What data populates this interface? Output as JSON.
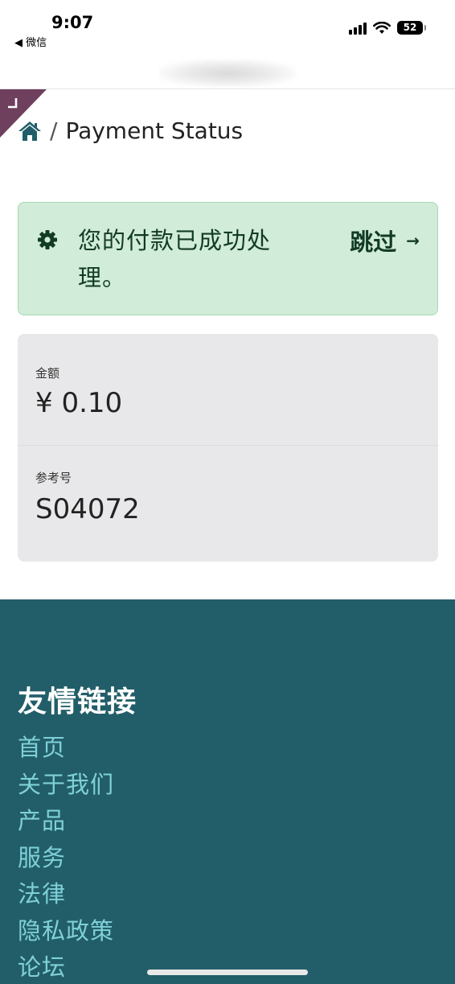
{
  "status_bar": {
    "time": "9:07",
    "back_app": "◀ 微信",
    "battery": "52"
  },
  "breadcrumb": {
    "separator": "/",
    "current": "Payment Status"
  },
  "alert": {
    "message": "您的付款已成功处理。",
    "skip_label": "跳过",
    "skip_arrow": "→",
    "colors": {
      "background": "#d1ecd9",
      "text": "#123b25"
    }
  },
  "payment": {
    "amount_label": "金额",
    "amount_value": "¥ 0.10",
    "reference_label": "参考号",
    "reference_value": "S04072"
  },
  "footer": {
    "title": "友情链接",
    "links": [
      "首页",
      "关于我们",
      "产品",
      "服务",
      "法律",
      "隐私政策",
      "论坛"
    ],
    "colors": {
      "background": "#225e69",
      "link": "#7fd0d8"
    }
  },
  "corner_ribbon_color": "#6f3f5e"
}
